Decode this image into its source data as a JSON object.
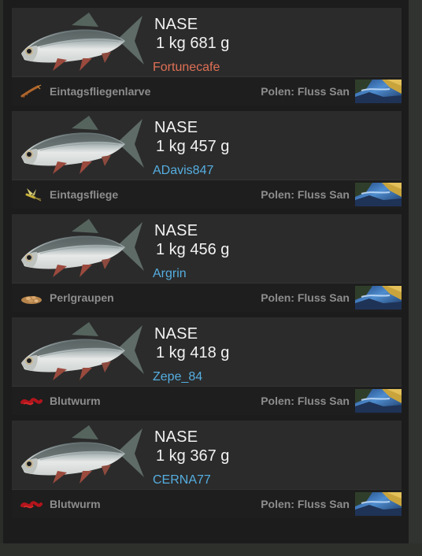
{
  "colors": {
    "player_highlight": "#e07055",
    "player_default": "#55aee0",
    "label_grey": "#8d8d8d",
    "text_white": "#f2f2f2"
  },
  "catches": [
    {
      "fish": "NASE",
      "weight": "1 kg 681 g",
      "player": "Fortunecafe",
      "player_color": "#e07055",
      "bait": "Eintagsfliegenlarve",
      "bait_icon": "mayfly-larva-icon",
      "location": "Polen: Fluss San",
      "location_icon": "river-thumbnail"
    },
    {
      "fish": "NASE",
      "weight": "1 kg 457 g",
      "player": "ADavis847",
      "player_color": "#55aee0",
      "bait": "Eintagsfliege",
      "bait_icon": "mayfly-icon",
      "location": "Polen: Fluss San",
      "location_icon": "river-thumbnail"
    },
    {
      "fish": "NASE",
      "weight": "1 kg 456 g",
      "player": "Argrin",
      "player_color": "#55aee0",
      "bait": "Perlgraupen",
      "bait_icon": "pearl-barley-icon",
      "location": "Polen: Fluss San",
      "location_icon": "river-thumbnail"
    },
    {
      "fish": "NASE",
      "weight": "1 kg 418 g",
      "player": "Zepe_84",
      "player_color": "#55aee0",
      "bait": "Blutwurm",
      "bait_icon": "bloodworm-icon",
      "location": "Polen: Fluss San",
      "location_icon": "river-thumbnail"
    },
    {
      "fish": "NASE",
      "weight": "1 kg 367 g",
      "player": "CERNA77",
      "player_color": "#55aee0",
      "bait": "Blutwurm",
      "bait_icon": "bloodworm-icon",
      "location": "Polen: Fluss San",
      "location_icon": "river-thumbnail"
    }
  ]
}
